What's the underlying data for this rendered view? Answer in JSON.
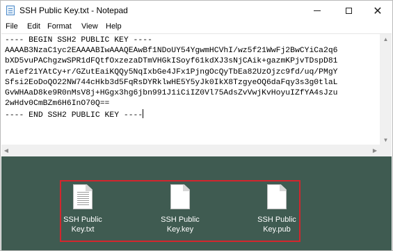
{
  "window": {
    "title": "SSH Public Key.txt - Notepad",
    "controls": {
      "minimize_icon": "minimize-icon",
      "maximize_icon": "maximize-icon",
      "close_icon": "close-icon",
      "close_glyph": "✕"
    }
  },
  "menubar": {
    "items": [
      "File",
      "Edit",
      "Format",
      "View",
      "Help"
    ]
  },
  "editor": {
    "lines": [
      "---- BEGIN SSH2 PUBLIC KEY ----",
      "AAAAB3NzaC1yc2EAAAABIwAAAQEAwBf1NDoUY54YgwmHCVhI/wz5f21WwFj2BwCYiCa2q6",
      "bXD5vuPAChgzwSPR1dFQtfOxzezaDTmVHGkISoyf61kdXJ3sNjCAik+gazmKPjvTDspD81",
      "rAief21YAtCy+r/GZutEaiKQQy5NqIxbGe4JFx1PjngOcQyTbEa82UzOjzc9fd/uq/PMgY",
      "Sfsi2EoDoQO22NW744cHkb3d5FqRsDYRklwHE5Y5yJk0IkX8TzgyeOQ6daFqy3s3g0tlaL",
      "GvWHAaD8ke9R0nMsV8j+HGgx3hg6jbn991J1iCiIZ0Vl75AdsZvVwjKvHoyuIZfYA4sJzu",
      "2wHdv0CmBZm6H6InO70Q==",
      "---- END SSH2 PUBLIC KEY ----"
    ]
  },
  "desktop": {
    "files": [
      {
        "label": "SSH Public\nKey.txt",
        "icon": "text-file-icon"
      },
      {
        "label": "SSH Public\nKey.key",
        "icon": "file-icon"
      },
      {
        "label": "SSH Public\nKey.pub",
        "icon": "file-icon"
      }
    ],
    "highlight_color": "#d3262d",
    "background_color": "#3f5b51"
  }
}
